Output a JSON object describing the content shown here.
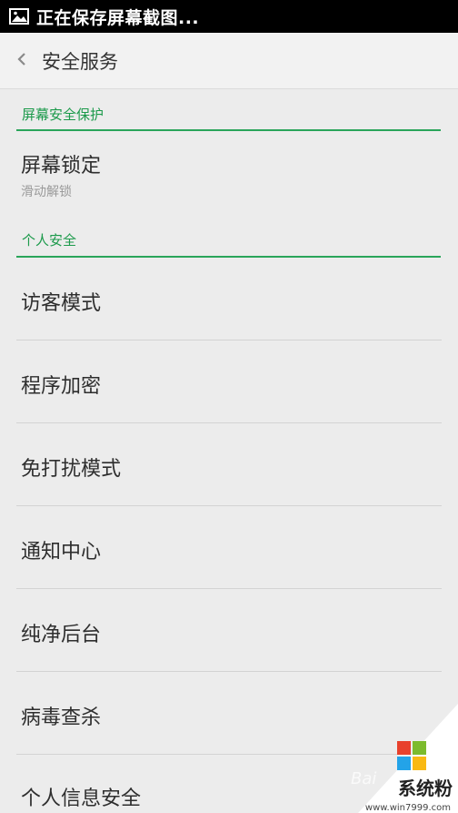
{
  "status_bar": {
    "icon": "image-icon",
    "text": "正在保存屏幕截图..."
  },
  "header": {
    "back_icon": "chevron-left-icon",
    "title": "安全服务"
  },
  "sections": [
    {
      "title": "屏幕安全保护",
      "items": [
        {
          "title": "屏幕锁定",
          "subtitle": "滑动解锁"
        }
      ]
    },
    {
      "title": "个人安全",
      "items": [
        {
          "title": "访客模式"
        },
        {
          "title": "程序加密"
        },
        {
          "title": "免打扰模式"
        },
        {
          "title": "通知中心"
        },
        {
          "title": "纯净后台"
        },
        {
          "title": "病毒查杀"
        },
        {
          "title": "个人信息安全"
        }
      ]
    }
  ],
  "watermark": {
    "logo_icon": "windows-logo-icon",
    "brand": "系统粉",
    "url": "www.win7999.com",
    "baidu": "Bai"
  },
  "colors": {
    "accent": "#1c9a4b",
    "divider": "#d3d3d3",
    "background": "#ececec",
    "status_bar": "#000000"
  }
}
